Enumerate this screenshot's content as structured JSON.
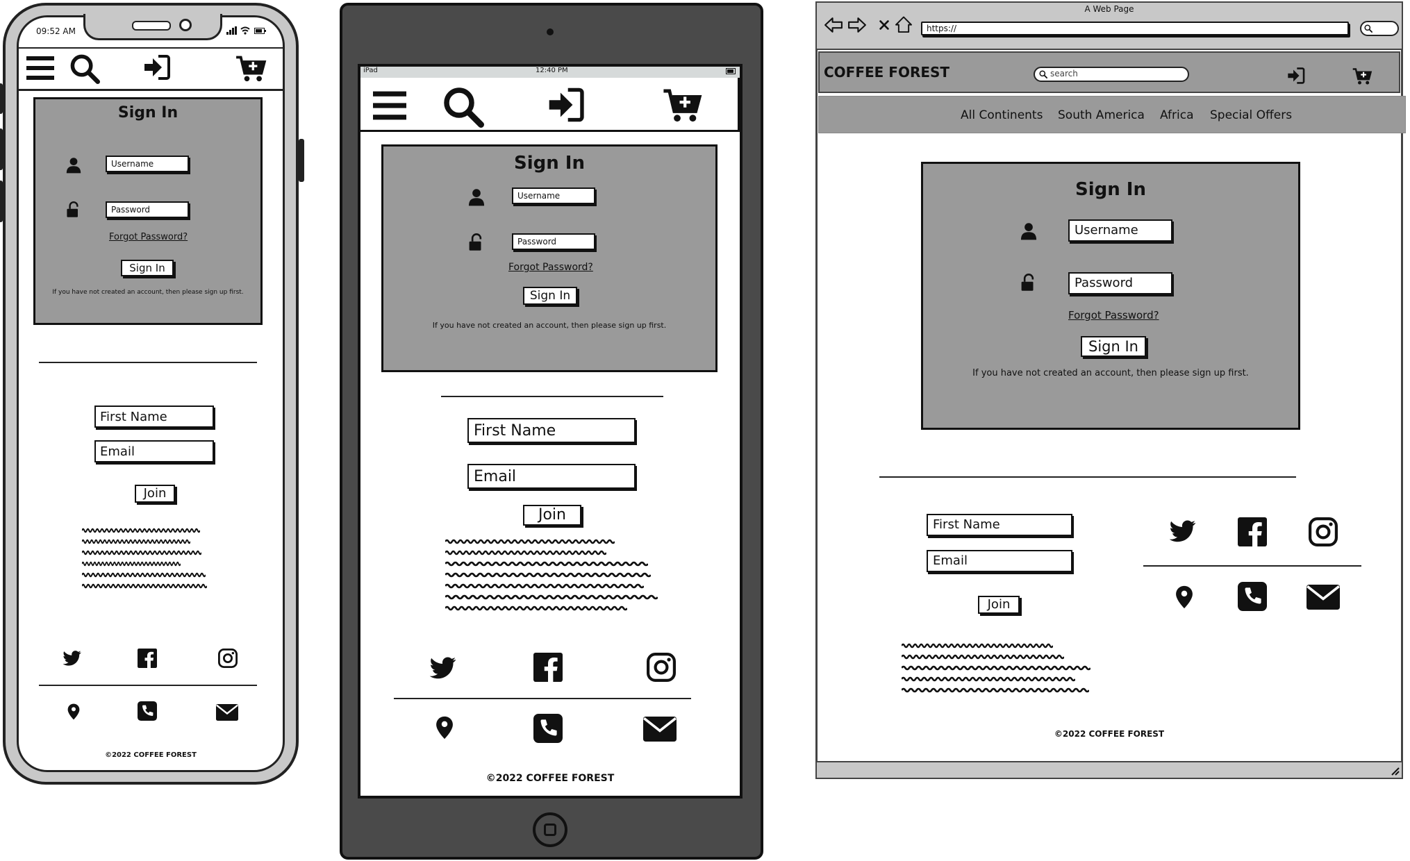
{
  "phone": {
    "time": "09:52 AM",
    "signin": {
      "title": "Sign In",
      "username_placeholder": "Username",
      "password_placeholder": "Password",
      "forgot": "Forgot Password?",
      "button": "Sign In",
      "note": "If you have not created an account, then please sign up first."
    },
    "newsletter": {
      "first_name": "First Name",
      "email": "Email",
      "join": "Join"
    },
    "footer": "©2022 COFFEE FOREST"
  },
  "tablet": {
    "carrier": "iPad",
    "time": "12:40 PM",
    "signin": {
      "title": "Sign In",
      "username_placeholder": "Username",
      "password_placeholder": "Password",
      "forgot": "Forgot Password?",
      "button": "Sign In",
      "note": "If you have not created an account, then please sign up first."
    },
    "newsletter": {
      "first_name": "First Name",
      "email": "Email",
      "join": "Join"
    },
    "footer": "©2022 COFFEE FOREST"
  },
  "browser": {
    "window_title": "A Web Page",
    "url": "https://",
    "brand": "COFFEE FOREST",
    "search_placeholder": "search",
    "nav": [
      "All Continents",
      "South America",
      "Africa",
      "Special Offers"
    ],
    "signin": {
      "title": "Sign In",
      "username_placeholder": "Username",
      "password_placeholder": "Password",
      "forgot": "Forgot Password?",
      "button": "Sign In",
      "note": "If you have not created an account, then please sign up first."
    },
    "newsletter": {
      "first_name": "First Name",
      "email": "Email",
      "join": "Join"
    },
    "footer": "©2022 COFFEE FOREST"
  },
  "icons": [
    "menu-icon",
    "search-icon",
    "sign-in-icon",
    "cart-add-icon",
    "user-icon",
    "unlock-icon",
    "twitter-icon",
    "facebook-icon",
    "instagram-icon",
    "location-pin-icon",
    "phone-icon",
    "mail-icon",
    "back-icon",
    "forward-icon",
    "close-icon",
    "home-icon"
  ],
  "colors": {
    "panel": "#9a9a9a",
    "device_dark": "#4a4a4a",
    "device_light": "#c8c8c8",
    "ink": "#111111"
  }
}
